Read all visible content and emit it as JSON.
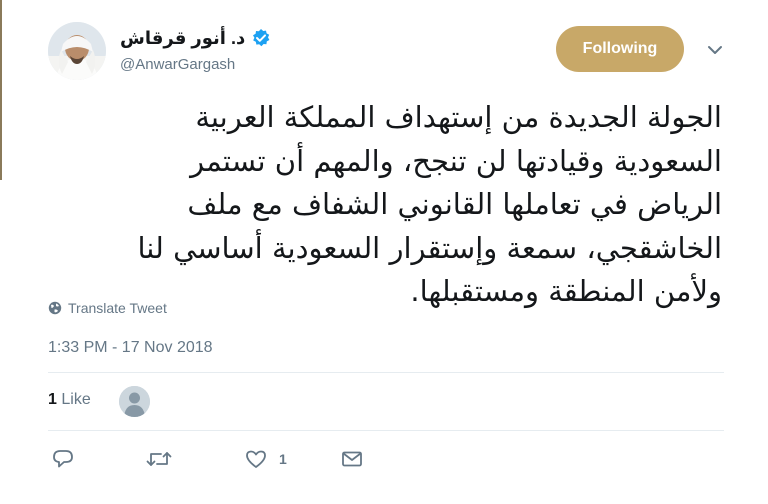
{
  "colors": {
    "follow_button_bg": "#c8a868",
    "verified_badge": "#1da1f2",
    "secondary_text": "#657786",
    "primary_text": "#14171a"
  },
  "author": {
    "display_name": "د. أنور قرقاش",
    "handle": "@AnwarGargash",
    "verified": true,
    "avatar_icon": "profile-photo"
  },
  "header": {
    "follow_label": "Following",
    "menu_icon": "chevron-down-icon"
  },
  "tweet": {
    "lines": [
      "الجولة الجديدة من إستهداف المملكة العربية",
      "السعودية وقيادتها لن تنجح، والمهم أن تستمر",
      "الرياض في تعاملها القانوني الشفاف مع ملف",
      "الخاشقجي، سمعة وإستقرار السعودية أساسي لنا",
      "ولأمن المنطقة ومستقبلها."
    ],
    "translate_label": "Translate Tweet",
    "timestamp": "1:33 PM - 17 Nov 2018"
  },
  "stats": {
    "likes_count": "1",
    "likes_label": "Like"
  },
  "actions": {
    "reply_icon": "reply-icon",
    "retweet_icon": "retweet-icon",
    "like_icon": "heart-icon",
    "like_count": "1",
    "message_icon": "envelope-icon"
  }
}
